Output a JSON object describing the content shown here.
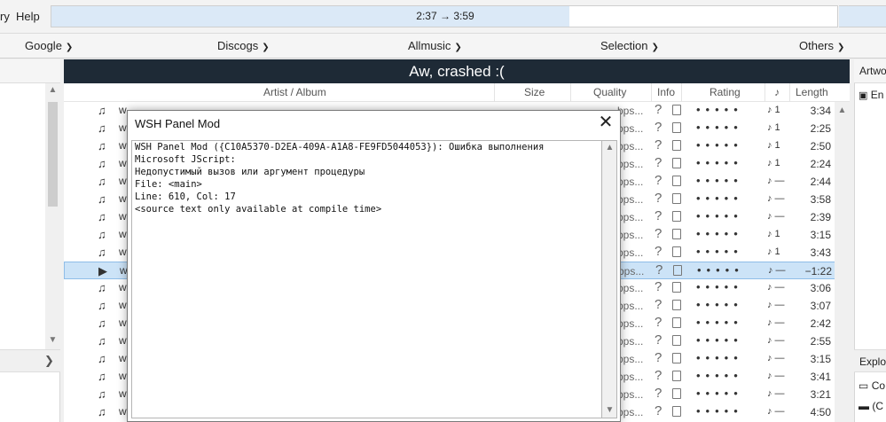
{
  "menu": {
    "items": [
      "ry",
      "Help"
    ]
  },
  "seek": {
    "text": "2:37 → 3:59",
    "progress": 0.659
  },
  "links": [
    {
      "label": "Google"
    },
    {
      "label": "Discogs"
    },
    {
      "label": "Allmusic"
    },
    {
      "label": "Selection"
    },
    {
      "label": "Others"
    }
  ],
  "playlist": {
    "title": "Aw, crashed :(",
    "columns": [
      "Artist / Album",
      "Size",
      "Quality",
      "Info",
      "Rating",
      "♪",
      "Length"
    ],
    "rows": [
      {
        "len": "3:34",
        "note": "♪ 1",
        "playing": false
      },
      {
        "len": "2:25",
        "note": "♪ 1",
        "playing": false
      },
      {
        "len": "2:50",
        "note": "♪ 1",
        "playing": false
      },
      {
        "len": "2:24",
        "note": "♪ 1",
        "playing": false
      },
      {
        "len": "2:44",
        "note": "♪ —",
        "playing": false
      },
      {
        "len": "3:58",
        "note": "♪ —",
        "playing": false
      },
      {
        "len": "2:39",
        "note": "♪ —",
        "playing": false
      },
      {
        "len": "3:15",
        "note": "♪ 1",
        "playing": false
      },
      {
        "len": "3:43",
        "note": "♪ 1",
        "playing": false
      },
      {
        "len": "−1:22",
        "note": "♪ —",
        "playing": true
      },
      {
        "len": "3:06",
        "note": "♪ —",
        "playing": false
      },
      {
        "len": "3:07",
        "note": "♪ —",
        "playing": false
      },
      {
        "len": "2:42",
        "note": "♪ —",
        "playing": false
      },
      {
        "len": "2:55",
        "note": "♪ —",
        "playing": false
      },
      {
        "len": "3:15",
        "note": "♪ —",
        "playing": false
      },
      {
        "len": "3:41",
        "note": "♪ —",
        "playing": false
      },
      {
        "len": "3:21",
        "note": "♪ —",
        "playing": false
      },
      {
        "len": "4:50",
        "note": "♪ —",
        "playing": false
      }
    ],
    "row_prefix": "w",
    "bps": "bps...",
    "rating_dots": "•••••"
  },
  "right": {
    "header": "Artwo",
    "item1": "En",
    "section2": "Explo",
    "item2": "Co",
    "item3": "(C"
  },
  "dialog": {
    "title": "WSH Panel Mod",
    "close": "✕",
    "lines": [
      "WSH Panel Mod ({C10A5370-D2EA-409A-A1A8-FE9FD5044053}): Ошибка выполнения",
      "Microsoft JScript:",
      "Недопустимый вызов или аргумент процедуры",
      "File: <main>",
      "Line: 610, Col: 17",
      "<source text only available at compile time>"
    ]
  }
}
